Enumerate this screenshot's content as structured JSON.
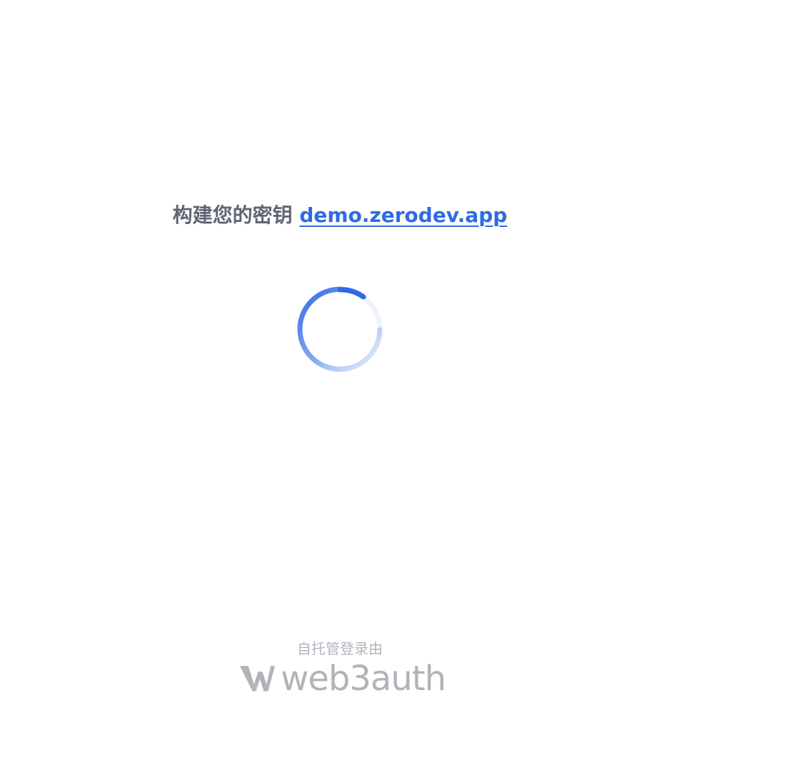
{
  "heading": {
    "prefix": "构建您的密钥",
    "domain": "demo.zerodev.app"
  },
  "spinner": {
    "state": "loading",
    "color": "#2f6ae5"
  },
  "footer": {
    "label": "自托管登录由",
    "brand_name": "web3auth",
    "brand_icon": "web3auth-logo-icon"
  },
  "colors": {
    "accent": "#2f6ae5",
    "heading_text": "#5e6673",
    "muted": "#b2b5bc"
  }
}
